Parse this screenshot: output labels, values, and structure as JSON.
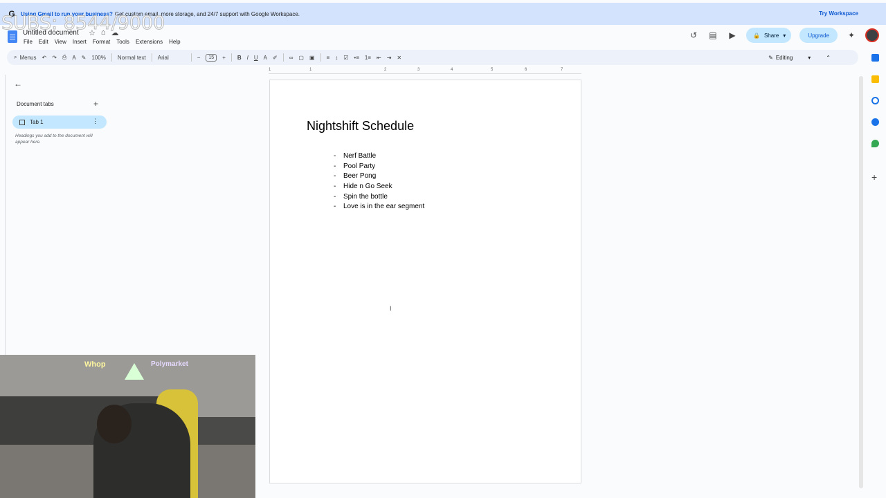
{
  "banner": {
    "logo": "G",
    "strong": "Using Gmail to run your business?",
    "text": "Get custom email, more storage, and 24/7 support with Google Workspace.",
    "cta": "Try Workspace"
  },
  "overlay": {
    "subs": "SUBS: 8544/9000"
  },
  "doc": {
    "title": "Untitled document",
    "menu": [
      "File",
      "Edit",
      "View",
      "Insert",
      "Format",
      "Tools",
      "Extensions",
      "Help"
    ]
  },
  "topright": {
    "share": "Share",
    "upgrade": "Upgrade"
  },
  "toolbar": {
    "menus": "Menus",
    "zoom": "100%",
    "style": "Normal text",
    "font": "Arial",
    "fontsize": "15",
    "mode": "Editing"
  },
  "ruler": {
    "ticks": [
      "1",
      "1",
      "2",
      "3",
      "4",
      "5",
      "6",
      "7"
    ]
  },
  "sidebar": {
    "heading": "Document tabs",
    "tab": "Tab 1",
    "hint": "Headings you add to the document will appear here."
  },
  "content": {
    "heading": "Nightshift Schedule",
    "items": [
      "Nerf Battle",
      "Pool Party",
      "Beer Pong",
      "Hide n Go Seek",
      "Spin the bottle",
      "Love is in the ear segment"
    ]
  },
  "webcam": {
    "brand1": "Whop",
    "brand2": "Polymarket"
  },
  "colors": {
    "accent": "#0b57d0",
    "pill": "#c2e7ff",
    "banner": "#d3e3fd"
  }
}
